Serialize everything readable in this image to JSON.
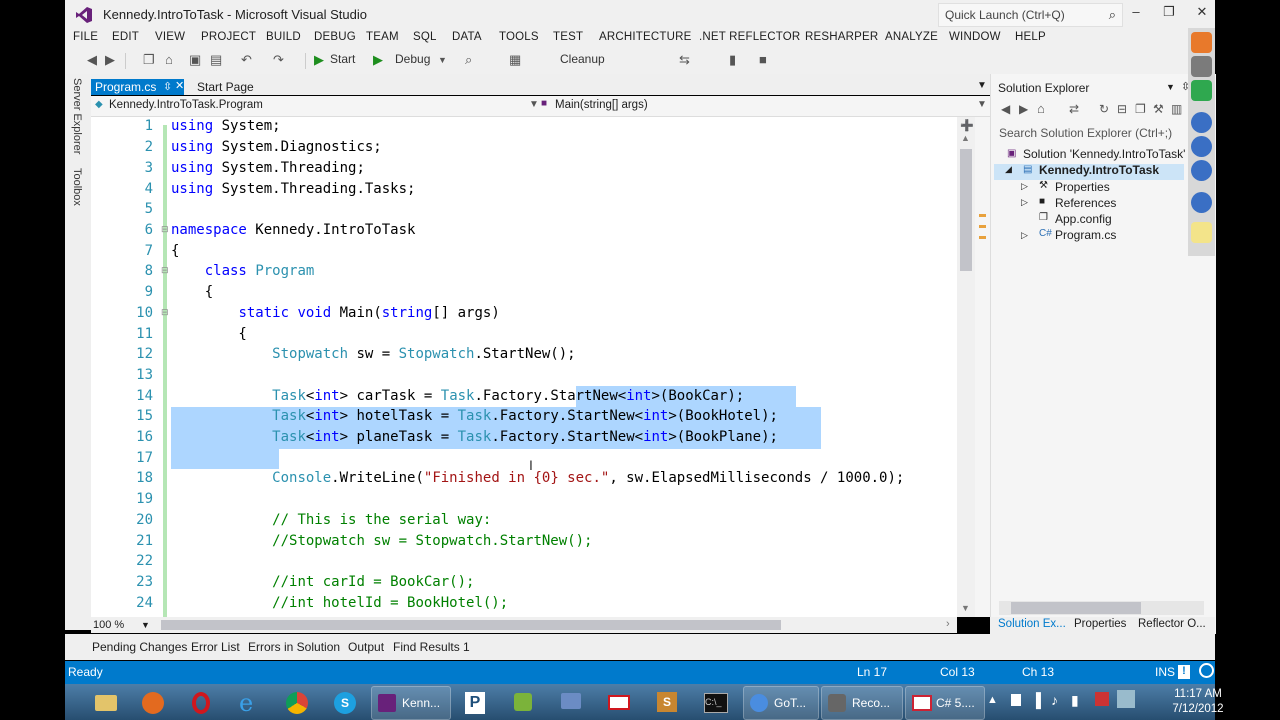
{
  "window": {
    "title": "Kennedy.IntroToTask - Microsoft Visual Studio",
    "quick_launch_placeholder": "Quick Launch (Ctrl+Q)"
  },
  "menu": [
    "FILE",
    "EDIT",
    "VIEW",
    "PROJECT",
    "BUILD",
    "DEBUG",
    "TEAM",
    "SQL",
    "DATA",
    "TOOLS",
    "TEST",
    "ARCHITECTURE",
    ".NET REFLECTOR",
    "RESHARPER",
    "ANALYZE",
    "WINDOW",
    "HELP"
  ],
  "toolbar": {
    "start_label": "Start",
    "config": "Debug",
    "cleanup_label": "Cleanup"
  },
  "side_tabs": [
    "Server Explorer",
    "Toolbox"
  ],
  "doc_tabs": [
    {
      "label": "Program.cs",
      "active": true
    },
    {
      "label": "Start Page",
      "active": false
    }
  ],
  "navbar": {
    "type": "Kennedy.IntroToTask.Program",
    "member": "Main(string[] args)"
  },
  "editor": {
    "lines": [
      "1",
      "2",
      "3",
      "4",
      "5",
      "6",
      "7",
      "8",
      "9",
      "10",
      "11",
      "12",
      "13",
      "14",
      "15",
      "16",
      "17",
      "18",
      "19",
      "20",
      "21",
      "22",
      "23",
      "24"
    ],
    "zoom": "100 %"
  },
  "solution_explorer": {
    "title": "Solution Explorer",
    "search_placeholder": "Search Solution Explorer (Ctrl+;)",
    "solution": "Solution 'Kennedy.IntroToTask'",
    "project": "Kennedy.IntroToTask",
    "items": [
      "Properties",
      "References",
      "App.config",
      "Program.cs"
    ],
    "bottom_tabs": [
      "Solution Ex...",
      "Properties",
      "Reflector O..."
    ]
  },
  "bottom_tabs": [
    "Pending Changes",
    "Error List",
    "Errors in Solution",
    "Output",
    "Find Results 1"
  ],
  "status": {
    "state": "Ready",
    "line": "Ln 17",
    "col": "Col 13",
    "ch": "Ch 13",
    "mode": "INS"
  },
  "taskbar": {
    "windows": [
      "Kenn...",
      "GoT...",
      "Reco...",
      "C# 5...."
    ],
    "time": "11:17 AM",
    "date": "7/12/2012"
  }
}
